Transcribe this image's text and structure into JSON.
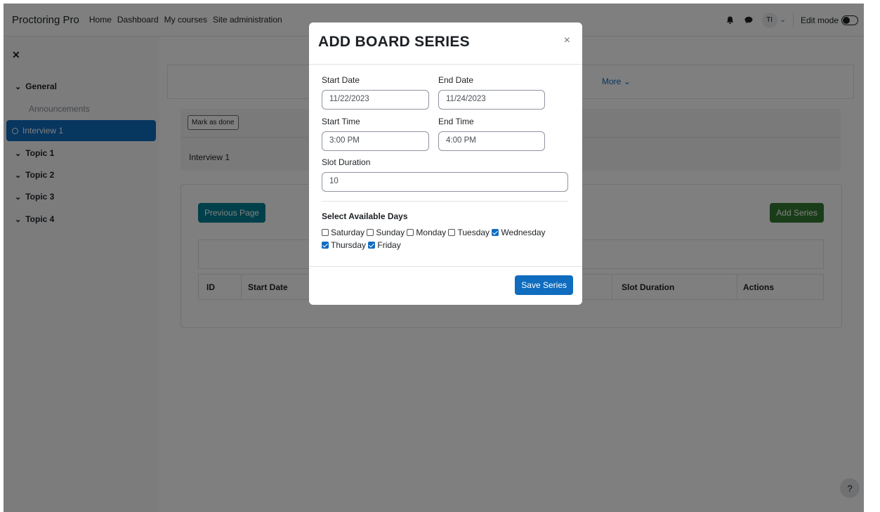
{
  "navbar": {
    "brand": "Proctoring Pro",
    "links": [
      "Home",
      "Dashboard",
      "My courses",
      "Site administration"
    ],
    "avatar_initials": "TI",
    "edit_mode_label": "Edit mode"
  },
  "sidebar": {
    "items": [
      {
        "label": "General"
      },
      {
        "label": "Announcements"
      },
      {
        "label": "Interview 1"
      },
      {
        "label": "Topic 1"
      },
      {
        "label": "Topic 2"
      },
      {
        "label": "Topic 3"
      },
      {
        "label": "Topic 4"
      }
    ]
  },
  "main": {
    "more_label": "More",
    "mark_done_label": "Mark as done",
    "activity_name": "Interview 1",
    "prev_page_label": "Previous Page",
    "add_series_label": "Add Series",
    "table_headers": [
      "ID",
      "Start Date",
      "Slot Duration",
      "Actions"
    ],
    "help_label": "?"
  },
  "modal": {
    "title": "ADD BOARD SERIES",
    "close_label": "×",
    "start_date_label": "Start Date",
    "start_date_value": "11/22/2023",
    "end_date_label": "End Date",
    "end_date_value": "11/24/2023",
    "start_time_label": "Start Time",
    "start_time_value": "3:00 PM",
    "end_time_label": "End Time",
    "end_time_value": "4:00 PM",
    "slot_duration_label": "Slot Duration",
    "slot_duration_value": "10",
    "days_title": "Select Available Days",
    "days": [
      {
        "label": "Saturday",
        "checked": false
      },
      {
        "label": "Sunday",
        "checked": false
      },
      {
        "label": "Monday",
        "checked": false
      },
      {
        "label": "Tuesday",
        "checked": false
      },
      {
        "label": "Wednesday",
        "checked": true
      },
      {
        "label": "Thursday",
        "checked": true
      },
      {
        "label": "Friday",
        "checked": true
      }
    ],
    "save_label": "Save Series"
  },
  "colors": {
    "primary": "#0f6cbf",
    "teal": "#008196",
    "green": "#357a32"
  }
}
